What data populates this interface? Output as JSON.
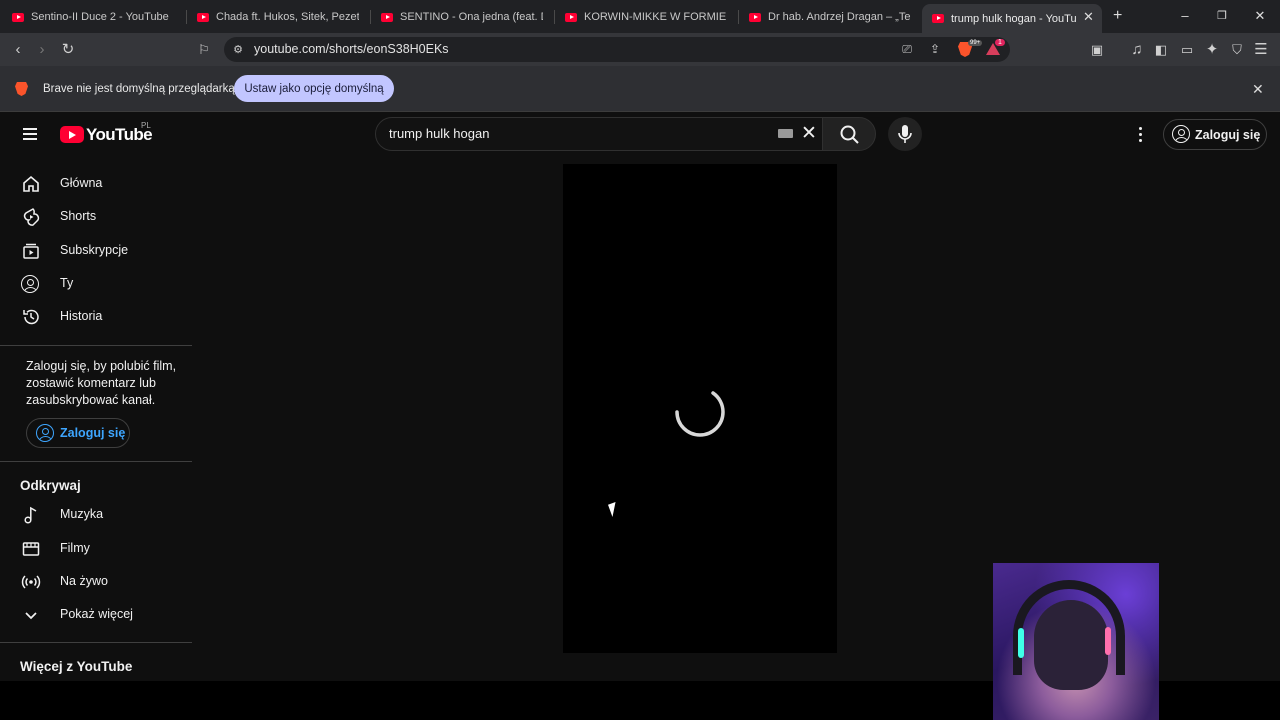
{
  "browser": {
    "tabs": [
      {
        "title": "Sentino-II Duce 2 - YouTube"
      },
      {
        "title": "Chada ft. Hukos, Sitek, Pezet, Pih"
      },
      {
        "title": "SENTINO - Ona jedna (feat. DIOR"
      },
      {
        "title": "KORWIN-MIKKE W FORMIE! TRU"
      },
      {
        "title": "Dr hab. Andrzej Dragan – „Teori"
      },
      {
        "title": "trump hulk hogan - YouTube",
        "active": true
      }
    ],
    "url": "youtube.com/shorts/eonS38H0EKs",
    "notification_count": "1",
    "shields_badge": "99+",
    "infobar": {
      "message": "Brave nie jest domyślną przeglądarką",
      "button_label": "Ustaw jako opcję domyślną"
    }
  },
  "youtube": {
    "logo_text": "YouTube",
    "country_code": "PL",
    "search": {
      "query": "trump hulk hogan"
    },
    "signin_label": "Zaloguj się",
    "sidebar": {
      "main_items": [
        {
          "label": "Główna",
          "icon": "home-icon"
        },
        {
          "label": "Shorts",
          "icon": "shorts-icon"
        },
        {
          "label": "Subskrypcje",
          "icon": "subscriptions-icon"
        },
        {
          "label": "Ty",
          "icon": "you-icon"
        },
        {
          "label": "Historia",
          "icon": "history-icon"
        }
      ],
      "signin_prompt": "Zaloguj się, by polubić film, zostawić komentarz lub zasubskrybować kanał.",
      "signin_button": "Zaloguj się",
      "explore_title": "Odkrywaj",
      "explore_items": [
        {
          "label": "Muzyka",
          "icon": "music-icon"
        },
        {
          "label": "Filmy",
          "icon": "film-icon"
        },
        {
          "label": "Na żywo",
          "icon": "live-icon"
        },
        {
          "label": "Pokaż więcej",
          "icon": "chevron-down-icon"
        }
      ],
      "more_title": "Więcej z YouTube"
    }
  },
  "colors": {
    "background": "#0f0f0f",
    "brand_red": "#ff0033",
    "link_blue": "#3ea6ff",
    "infobar_button": "#c2c6ff"
  }
}
